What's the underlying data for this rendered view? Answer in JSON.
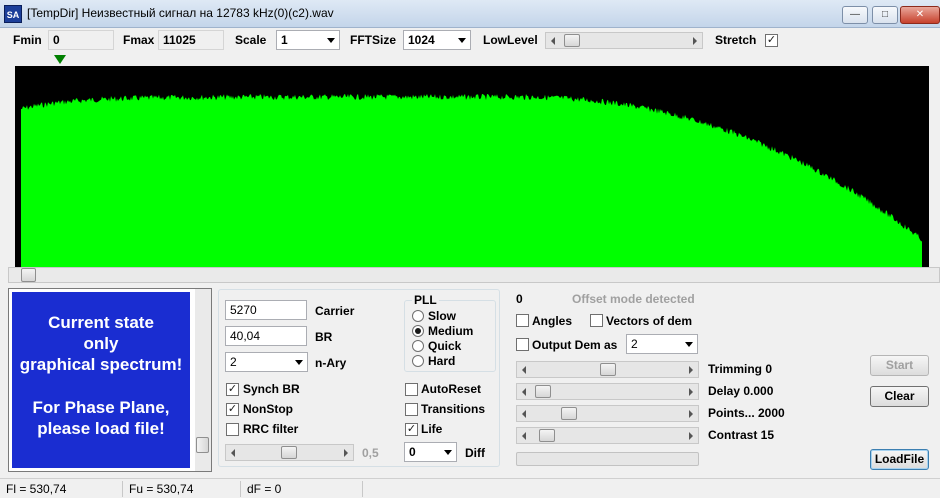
{
  "window": {
    "title": "[TempDir] Неизвестный сигнал на 12783 kHz(0)(c2).wav",
    "app_icon": "SA",
    "minimize": "—",
    "restore": "□",
    "close": "✕"
  },
  "toolbar": {
    "fmin_label": "Fmin",
    "fmin_value": "0",
    "fmax_label": "Fmax",
    "fmax_value": "11025",
    "scale_label": "Scale",
    "scale_value": "1",
    "fftsize_label": "FFTSize",
    "fftsize_value": "1024",
    "lowlevel_label": "LowLevel",
    "stretch_label": "Stretch",
    "stretch_checked": true
  },
  "spectrum": {
    "background": "#000000",
    "fill": "#00ff00",
    "marker_color": "#008000"
  },
  "state_panel": {
    "line1": "Current state",
    "line2": "only",
    "line3": "graphical spectrum!",
    "line4": "For Phase Plane,",
    "line5": "please load file!",
    "background": "#1a2dd1"
  },
  "demod": {
    "carrier_value": "5270",
    "carrier_label": "Carrier",
    "br_value": "40,04",
    "br_label": "BR",
    "nary_value": "2",
    "nary_label": "n-Ary",
    "synch_br_label": "Synch BR",
    "synch_br_checked": true,
    "nonstop_label": "NonStop",
    "nonstop_checked": true,
    "rrc_label": "RRC filter",
    "rrc_checked": false,
    "slider_value": "0,5",
    "pll_title": "PLL",
    "pll_slow": "Slow",
    "pll_medium": "Medium",
    "pll_quick": "Quick",
    "pll_hard": "Hard",
    "pll_selected": "Medium",
    "autoreset_label": "AutoReset",
    "autoreset_checked": false,
    "transitions_label": "Transitions",
    "transitions_checked": false,
    "life_label": "Life",
    "life_checked": true,
    "diff_value": "0",
    "diff_label": "Diff"
  },
  "output": {
    "offset_value": "0",
    "offset_status": "Offset mode detected",
    "angles_label": "Angles",
    "angles_checked": false,
    "vectors_label": "Vectors of dem",
    "vectors_checked": false,
    "output_dem_label": "Output Dem as",
    "output_dem_checked": false,
    "output_dem_value": "2",
    "trimming_label": "Trimming 0",
    "delay_label": "Delay  0.000",
    "points_label": "Points... 2000",
    "contrast_label": "Contrast 15"
  },
  "buttons": {
    "start": "Start",
    "clear": "Clear",
    "loadfile": "LoadFile"
  },
  "status": {
    "fl": "Fl = 530,74",
    "fu": "Fu = 530,74",
    "df": "dF = 0"
  }
}
